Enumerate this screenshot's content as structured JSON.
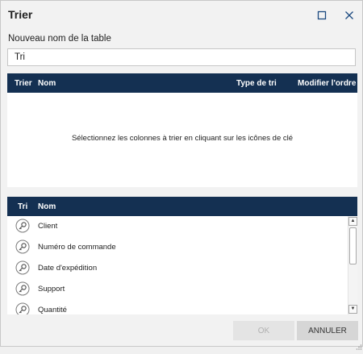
{
  "dialog": {
    "title": "Trier",
    "maximize_icon": "maximize-icon",
    "close_icon": "close-icon"
  },
  "table_name": {
    "label": "Nouveau nom de la table",
    "value": "Tri"
  },
  "sort_table": {
    "headers": [
      "Trier",
      "Nom",
      "Type de tri",
      "Modifier l'ordre"
    ],
    "placeholder": "Sélectionnez les colonnes à trier en cliquant sur les icônes de clé"
  },
  "columns_table": {
    "headers": [
      "Tri",
      "Nom"
    ],
    "items": [
      {
        "label": "Client",
        "icon": "key-icon"
      },
      {
        "label": "Numéro de commande",
        "icon": "key-icon"
      },
      {
        "label": "Date d'expédition",
        "icon": "key-icon"
      },
      {
        "label": "Support",
        "icon": "key-icon"
      },
      {
        "label": "Quantité",
        "icon": "key-icon"
      }
    ]
  },
  "buttons": {
    "ok": "OK",
    "cancel": "ANNULER"
  },
  "colors": {
    "header_bg": "#143052",
    "dialog_bg": "#f2f2f2",
    "ok_disabled_text": "#b0b0b0"
  }
}
